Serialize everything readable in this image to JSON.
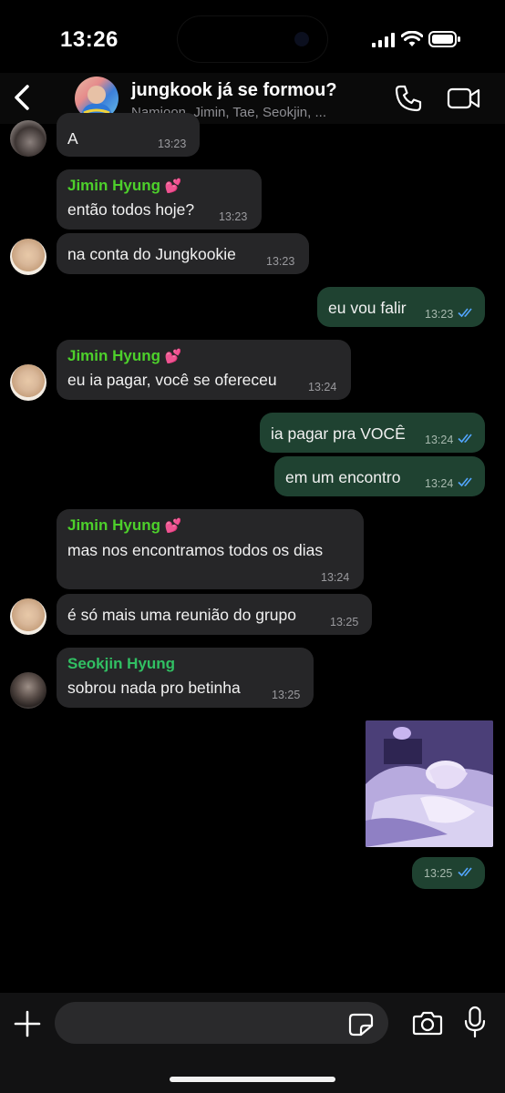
{
  "status_bar": {
    "time": "13:26"
  },
  "header": {
    "title": "jungkook já se formou?",
    "members": "Namjoon, Jimin, Tae, Seokjin, ..."
  },
  "messages": [
    {
      "direction": "in",
      "sender": "",
      "text": "A",
      "time": "13:23"
    },
    {
      "direction": "in",
      "sender": "Jimin Hyung",
      "text": "então todos hoje?",
      "time": "13:23"
    },
    {
      "direction": "in",
      "sender": "",
      "text": "na conta do Jungkookie",
      "time": "13:23"
    },
    {
      "direction": "out",
      "sender": "",
      "text": "eu vou falir",
      "time": "13:23"
    },
    {
      "direction": "in",
      "sender": "Jimin Hyung",
      "text": "eu ia pagar, você se ofereceu",
      "time": "13:24"
    },
    {
      "direction": "out",
      "sender": "",
      "text": "ia pagar pra VOCÊ",
      "time": "13:24"
    },
    {
      "direction": "out",
      "sender": "",
      "text": "em um encontro",
      "time": "13:24"
    },
    {
      "direction": "in",
      "sender": "Jimin Hyung",
      "text": "mas nos encontramos todos os dias",
      "time": "13:24"
    },
    {
      "direction": "in",
      "sender": "",
      "text": "é só mais uma reunião do grupo",
      "time": "13:25"
    },
    {
      "direction": "in",
      "sender": "Seokjin Hyung",
      "text": "sobrou nada pro betinha",
      "time": "13:25"
    },
    {
      "direction": "out",
      "sender": "",
      "text": "",
      "time": "13:25",
      "image": "anime-illustration"
    }
  ],
  "composer": {
    "placeholder": ""
  },
  "colors": {
    "incoming_bubble": "#262628",
    "outgoing_bubble": "#1f4231",
    "read_ticks": "#53a6ff",
    "jimin_name": "#4dd02b",
    "seokjin_name": "#31c063"
  },
  "icons": [
    "back-chevron-icon",
    "phone-icon",
    "video-icon",
    "plus-icon",
    "sticker-icon",
    "camera-icon",
    "microphone-icon",
    "double-check-icon",
    "heart-emoji-icon"
  ]
}
